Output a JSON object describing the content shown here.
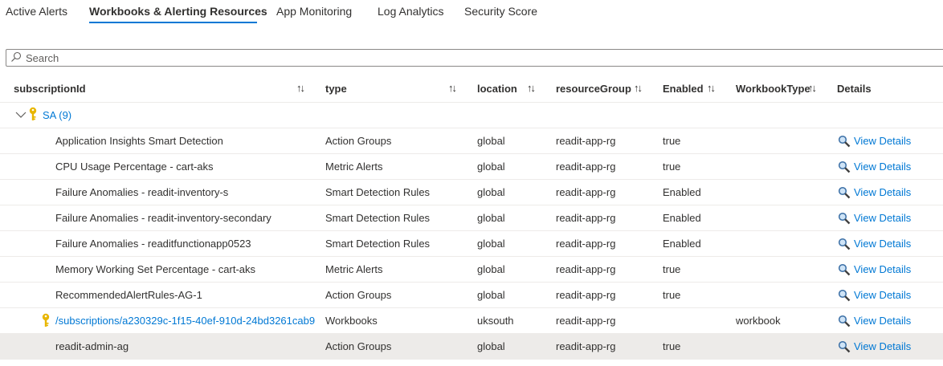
{
  "tabs": [
    {
      "label": "Active Alerts"
    },
    {
      "label": "Workbooks & Alerting Resources"
    },
    {
      "label": "App Monitoring"
    },
    {
      "label": "Log Analytics"
    },
    {
      "label": "Security Score"
    }
  ],
  "active_tab": "Workbooks & Alerting Resources",
  "search": {
    "placeholder": "Search"
  },
  "columns": {
    "subscriptionId": "subscriptionId",
    "type": "type",
    "location": "location",
    "resourceGroup": "resourceGroup",
    "enabled": "Enabled",
    "workbookType": "WorkbookType",
    "details": "Details"
  },
  "sort_icon": "↑↓",
  "group": {
    "label": "SA (9)"
  },
  "rows": [
    {
      "name": "Application Insights Smart Detection",
      "type": "Action Groups",
      "location": "global",
      "resourceGroup": "readit-app-rg",
      "enabled": "true",
      "workbookType": "",
      "details": "View Details"
    },
    {
      "name": "CPU Usage Percentage - cart-aks",
      "type": "Metric Alerts",
      "location": "global",
      "resourceGroup": "readit-app-rg",
      "enabled": "true",
      "workbookType": "",
      "details": "View Details"
    },
    {
      "name": "Failure Anomalies - readit-inventory-s",
      "type": "Smart Detection Rules",
      "location": "global",
      "resourceGroup": "readit-app-rg",
      "enabled": "Enabled",
      "workbookType": "",
      "details": "View Details"
    },
    {
      "name": "Failure Anomalies - readit-inventory-secondary",
      "type": "Smart Detection Rules",
      "location": "global",
      "resourceGroup": "readit-app-rg",
      "enabled": "Enabled",
      "workbookType": "",
      "details": "View Details"
    },
    {
      "name": "Failure Anomalies - readitfunctionapp0523",
      "type": "Smart Detection Rules",
      "location": "global",
      "resourceGroup": "readit-app-rg",
      "enabled": "Enabled",
      "workbookType": "",
      "details": "View Details"
    },
    {
      "name": "Memory Working Set Percentage - cart-aks",
      "type": "Metric Alerts",
      "location": "global",
      "resourceGroup": "readit-app-rg",
      "enabled": "true",
      "workbookType": "",
      "details": "View Details"
    },
    {
      "name": "RecommendedAlertRules-AG-1",
      "type": "Action Groups",
      "location": "global",
      "resourceGroup": "readit-app-rg",
      "enabled": "true",
      "workbookType": "",
      "details": "View Details"
    },
    {
      "name": "/subscriptions/a230329c-1f15-40ef-910d-24bd3261cab9",
      "type": "Workbooks",
      "location": "uksouth",
      "resourceGroup": "readit-app-rg",
      "enabled": "",
      "workbookType": "workbook",
      "details": "View Details"
    },
    {
      "name": "readit-admin-ag",
      "type": "Action Groups",
      "location": "global",
      "resourceGroup": "readit-app-rg",
      "enabled": "true",
      "workbookType": "",
      "details": "View Details"
    }
  ],
  "icons": {
    "search": "search-icon",
    "chevron": "chevron-down-icon",
    "key": "key-icon",
    "details": "magnifier-icon"
  },
  "colors": {
    "accent": "#0078d4",
    "key": "#e8b600",
    "selected_row": "#edebe9"
  }
}
